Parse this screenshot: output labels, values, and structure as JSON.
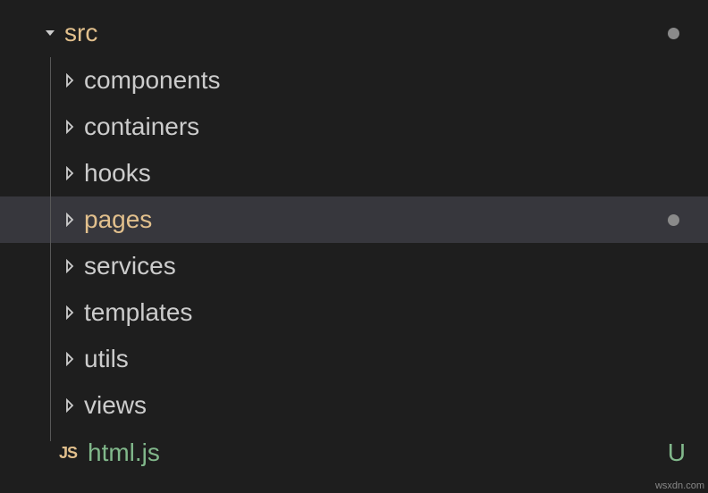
{
  "tree": {
    "root": {
      "label": "src",
      "expanded": true,
      "modified": true
    },
    "children": [
      {
        "label": "components",
        "type": "folder"
      },
      {
        "label": "containers",
        "type": "folder"
      },
      {
        "label": "hooks",
        "type": "folder"
      },
      {
        "label": "pages",
        "type": "folder",
        "selected": true,
        "modified": true
      },
      {
        "label": "services",
        "type": "folder"
      },
      {
        "label": "templates",
        "type": "folder"
      },
      {
        "label": "utils",
        "type": "folder"
      },
      {
        "label": "views",
        "type": "folder"
      }
    ],
    "file": {
      "label": "html.js",
      "iconText": "JS",
      "status": "U"
    }
  },
  "watermark": "wsxdn.com"
}
